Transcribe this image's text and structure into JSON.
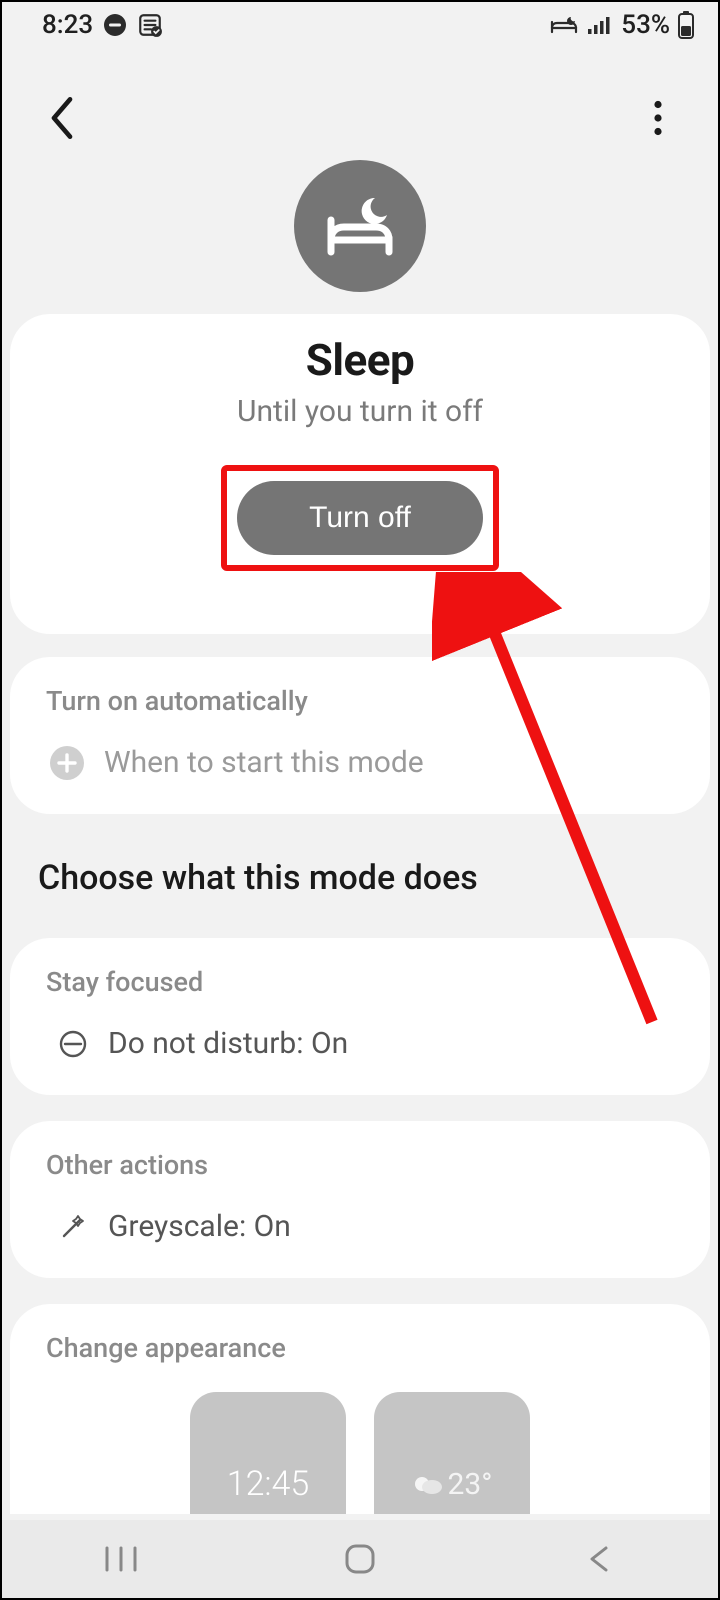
{
  "status": {
    "time": "8:23",
    "battery_pct": "53%"
  },
  "hero": {
    "title": "Sleep",
    "subtitle": "Until you turn it off",
    "button_label": "Turn off"
  },
  "sections": {
    "auto": {
      "label": "Turn on automatically",
      "row": "When to start this mode"
    },
    "heading": "Choose what this mode does",
    "focus": {
      "label": "Stay focused",
      "row": "Do not disturb: On"
    },
    "other": {
      "label": "Other actions",
      "row": "Greyscale: On"
    },
    "appearance": {
      "label": "Change appearance",
      "clock_preview": "12:45",
      "weather_temp": "23°"
    }
  }
}
